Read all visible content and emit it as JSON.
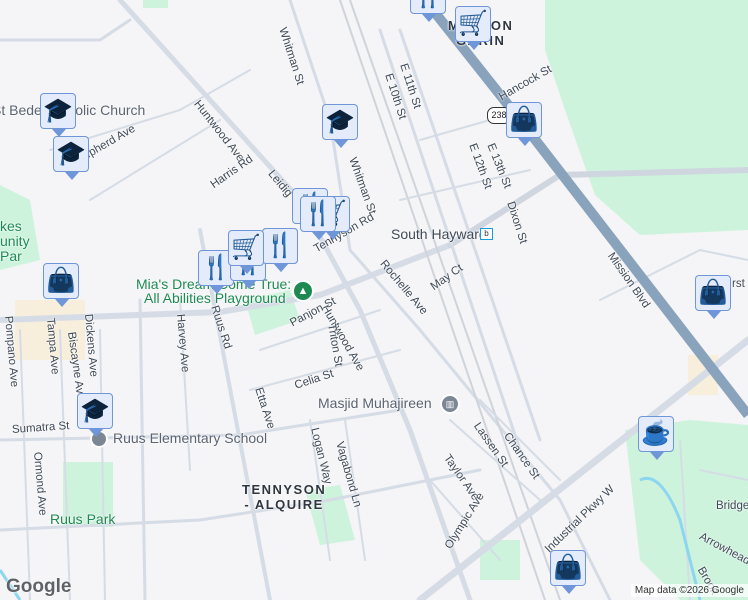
{
  "streets": {
    "whitman1": "Whitman St",
    "whitman2": "Whitman St",
    "huntwood1": "Huntwood Ave",
    "huntwood2": "Huntwood Ave",
    "harris": "Harris Rd",
    "leidig": "Leidig",
    "tennyson": "Tennyson Rd",
    "shepherd": "Shepherd Ave",
    "e11": "E 11th St",
    "e10": "E 10th St",
    "hancock": "Hancock St",
    "e13": "E 13th St",
    "e12": "E 12th St",
    "dixon": "Dixon St",
    "mission": "Mission Blvd",
    "rochelle": "Rochelle Ave",
    "may": "May Ct",
    "panjon": "Panjon St",
    "triton": "Triton St",
    "celia": "Celia St",
    "etta": "Etta Ave",
    "harvey": "Harvey Ave",
    "ruus": "Ruus Rd",
    "dickens": "Dickens Ave",
    "biscayne": "Biscayne Ave",
    "tampa": "Tampa Ave",
    "pompano": "Pompano Ave",
    "ormond": "Ormond Ave",
    "sumatra": "Sumatra St",
    "logan": "Logan Way",
    "vagabond": "Vagabond Ln",
    "lassen": "Lassen St",
    "chance": "Chance St",
    "taylor": "Taylor Ave",
    "olympic": "Olympic Ave",
    "industrial": "Industrial Pkwy W",
    "bridge": "Bridge",
    "arrowhead": "Arrowhead Way",
    "brook": "Brook",
    "hurst": "rst",
    "route": "238"
  },
  "places": {
    "church": "St Bede Catholic Church",
    "playground1": "Mia's Dream Come True:",
    "playground2": "All Abilities Playground",
    "station": "South Hayward",
    "school": "Ruus Elementary School",
    "park": "Ruus Park",
    "mosque": "Masjid Muhajireen",
    "lakes1": "kes",
    "lakes2": "unity",
    "lakes3": "Par",
    "hood1a": "MISSION",
    "hood1b": "GARIN",
    "hood2a": "TENNYSON",
    "hood2b": "- ALQUIRE"
  },
  "markers": [
    "school",
    "school",
    "school",
    "school",
    "cart",
    "cart",
    "cart",
    "bag",
    "bag",
    "bag",
    "bag",
    "coffee",
    "restaurant",
    "restaurant",
    "restaurant",
    "restaurant",
    "restaurant",
    "cart",
    "restaurant"
  ],
  "icons": {
    "school": "graduation-cap-icon",
    "cart": "shopping-cart-icon",
    "bag": "shopping-bag-icon",
    "coffee": "coffee-cup-icon",
    "restaurant": "fork-knife-icon"
  },
  "footer": {
    "logo": "Google",
    "attribution": "Map data ©2026 Google"
  },
  "colors": {
    "background": "#f5f4f6",
    "road": "#d5dce6",
    "highway": "#8aa3bd",
    "park": "#cdf3dc",
    "marker": "#0d3f63"
  }
}
